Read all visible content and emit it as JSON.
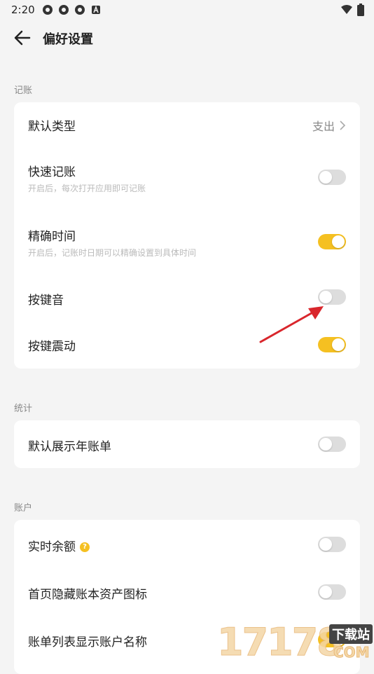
{
  "status_bar": {
    "time": "2:20"
  },
  "app_bar": {
    "title": "偏好设置"
  },
  "sections": [
    {
      "label": "记账",
      "rows": [
        {
          "title": "默认类型",
          "value": "支出"
        },
        {
          "title": "快速记账",
          "subtitle": "开启后，每次打开应用即可记账",
          "toggle": "off"
        },
        {
          "title": "精确时间",
          "subtitle": "开启后，记账时日期可以精确设置到具体时间",
          "toggle": "on"
        },
        {
          "title": "按键音",
          "toggle": "off"
        },
        {
          "title": "按键震动",
          "toggle": "on"
        }
      ]
    },
    {
      "label": "统计",
      "rows": [
        {
          "title": "默认展示年账单",
          "toggle": "off"
        }
      ]
    },
    {
      "label": "账户",
      "rows": [
        {
          "title": "实时余额",
          "help_icon": "?",
          "toggle": "off"
        },
        {
          "title": "首页隐藏账本资产图标",
          "toggle": "off"
        },
        {
          "title": "账单列表显示账户名称",
          "toggle": "on"
        }
      ]
    }
  ],
  "watermark": {
    "number": "17178",
    "site": "下载站",
    "domain": "COM"
  },
  "colors": {
    "accent": "#f5c021",
    "background": "#f4f4f4",
    "toggle_off": "#dddddd",
    "arrow": "#d9262c"
  }
}
